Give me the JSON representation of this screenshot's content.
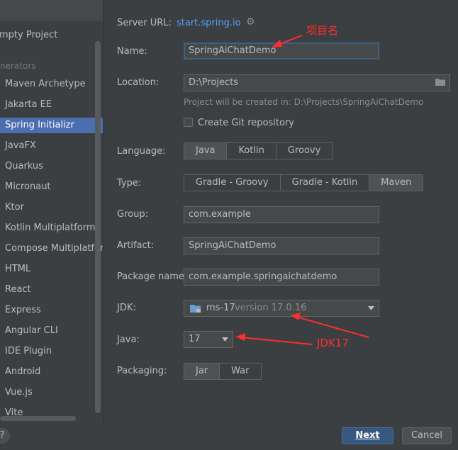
{
  "sidebar": {
    "top_item": "mpty Project",
    "section": "nerators",
    "items": [
      "Maven Archetype",
      "Jakarta EE",
      "Spring Initializr",
      "JavaFX",
      "Quarkus",
      "Micronaut",
      "Ktor",
      "Kotlin Multiplatform",
      "Compose Multiplatform",
      "HTML",
      "React",
      "Express",
      "Angular CLI",
      "IDE Plugin",
      "Android",
      "Vue.js",
      "Vite"
    ],
    "selected": "Spring Initializr"
  },
  "form": {
    "server_url_label": "Server URL:",
    "server_url": "start.spring.io",
    "name_label": "Name:",
    "name_value": "SpringAiChatDemo",
    "location_label": "Location:",
    "location_value": "D:\\Projects",
    "location_hint": "Project will be created in: D:\\Projects\\SpringAiChatDemo",
    "git_label": "Create Git repository",
    "language_label": "Language:",
    "languages": [
      "Java",
      "Kotlin",
      "Groovy"
    ],
    "language_selected": "Java",
    "type_label": "Type:",
    "types": [
      "Gradle - Groovy",
      "Gradle - Kotlin",
      "Maven"
    ],
    "type_selected": "Maven",
    "group_label": "Group:",
    "group_value": "com.example",
    "artifact_label": "Artifact:",
    "artifact_value": "SpringAiChatDemo",
    "package_label": "Package name:",
    "package_value": "com.example.springaichatdemo",
    "jdk_label": "JDK:",
    "jdk_name": "ms-17",
    "jdk_version": "version 17.0.16",
    "java_label": "Java:",
    "java_value": "17",
    "packaging_label": "Packaging:",
    "packagings": [
      "Jar",
      "War"
    ],
    "packaging_selected": "Jar"
  },
  "buttons": {
    "help": "?",
    "next": "Next",
    "cancel": "Cancel"
  },
  "annotations": {
    "project_name": "项目名",
    "jdk": "JDK17",
    "color": "#ff2d2d"
  },
  "colors": {
    "selection": "#4b6eaf",
    "link": "#589df6",
    "primary_button": "#365880"
  }
}
